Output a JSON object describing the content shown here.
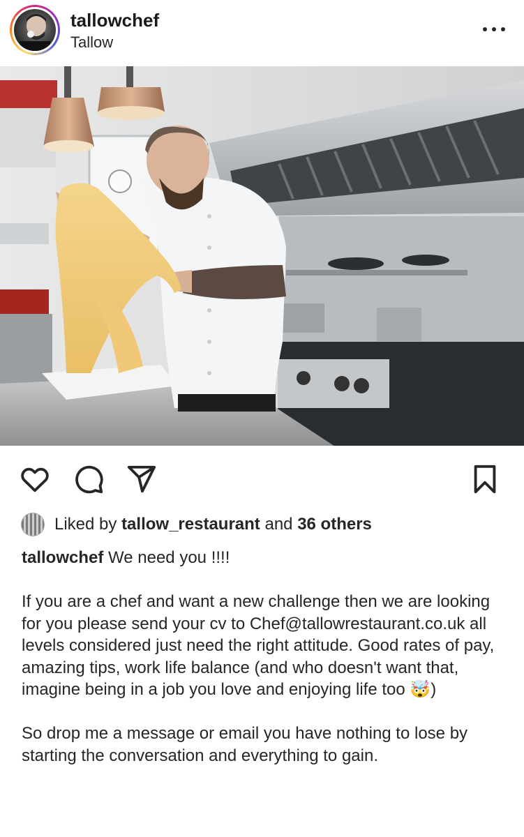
{
  "header": {
    "username": "tallowchef",
    "location": "Tallow",
    "more_icon": "more-horizontal-icon"
  },
  "post": {
    "photo_alt": "chef-rolling-pasta-photo"
  },
  "actions": {
    "like_icon": "heart-icon",
    "comment_icon": "comment-icon",
    "share_icon": "send-icon",
    "save_icon": "bookmark-icon"
  },
  "likes": {
    "prefix": "Liked by",
    "user": "tallow_restaurant",
    "middle": "and",
    "others": "36 others"
  },
  "caption": {
    "username": "tallowchef",
    "headline": "We need you !!!!",
    "body": "If you are a chef and want a new challenge then we are looking for you please send your cv to Chef@tallowrestaurant.co.uk all levels considered just need the right attitude. Good rates of pay, amazing tips, work life balance (and who doesn't want that, imagine being in a job you love and enjoying life too 🤯)",
    "closing": "So drop me a message or email you have nothing to lose by starting the conversation and everything to gain."
  }
}
